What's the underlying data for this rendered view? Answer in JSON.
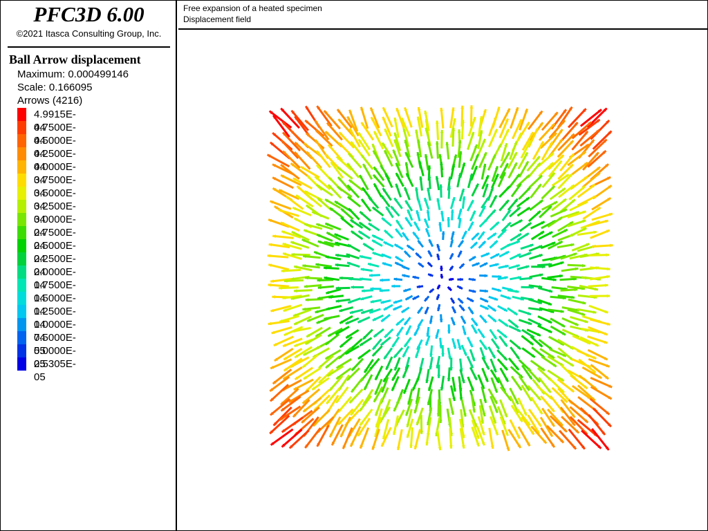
{
  "app": {
    "title": "PFC3D 6.00",
    "copyright": "©2021 Itasca Consulting Group, Inc."
  },
  "header": {
    "line1": "Free expansion of a heated specimen",
    "line2": "Displacement field"
  },
  "legend": {
    "title": "Ball Arrow displacement",
    "maximum_label": "Maximum: 0.000499146",
    "scale_label": "Scale: 0.166095",
    "arrows_label": "Arrows (4216)",
    "items": [
      {
        "label": "4.9915E-04",
        "color": "#ff0000"
      },
      {
        "label": "4.7500E-04",
        "color": "#ff3c00"
      },
      {
        "label": "4.5000E-04",
        "color": "#ff6400"
      },
      {
        "label": "4.2500E-04",
        "color": "#ff8c00"
      },
      {
        "label": "4.0000E-04",
        "color": "#ffb400"
      },
      {
        "label": "3.7500E-04",
        "color": "#ffdc00"
      },
      {
        "label": "3.5000E-04",
        "color": "#e6f000"
      },
      {
        "label": "3.2500E-04",
        "color": "#b4f000"
      },
      {
        "label": "3.0000E-04",
        "color": "#78e600"
      },
      {
        "label": "2.7500E-04",
        "color": "#3cdc00"
      },
      {
        "label": "2.5000E-04",
        "color": "#00d200"
      },
      {
        "label": "2.2500E-04",
        "color": "#00d23c"
      },
      {
        "label": "2.0000E-04",
        "color": "#00dc82"
      },
      {
        "label": "1.7500E-04",
        "color": "#00e6b4"
      },
      {
        "label": "1.5000E-04",
        "color": "#00dcdc"
      },
      {
        "label": "1.2500E-04",
        "color": "#00c8f0"
      },
      {
        "label": "1.0000E-04",
        "color": "#0096f0"
      },
      {
        "label": "7.5000E-05",
        "color": "#0064f0"
      },
      {
        "label": "5.0000E-05",
        "color": "#0032e6"
      },
      {
        "label": "2.5305E-05",
        "color": "#0000e6"
      }
    ]
  },
  "arrow_field": {
    "arrow_count": 4216,
    "max_displacement": 0.000499146,
    "min_displacement": 2.5305e-05
  }
}
